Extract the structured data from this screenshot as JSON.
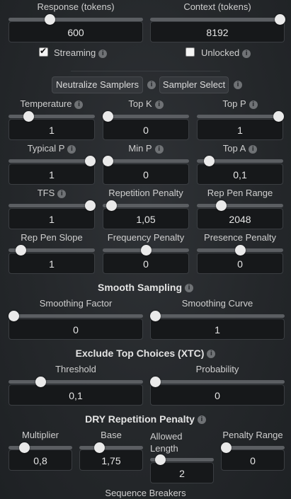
{
  "response": {
    "label": "Response (tokens)",
    "value": "600",
    "fraction": 0.29
  },
  "context": {
    "label": "Context (tokens)",
    "value": "8192",
    "fraction": 1.0
  },
  "streaming": {
    "label": "Streaming",
    "checked": true
  },
  "unlocked": {
    "label": "Unlocked",
    "checked": false
  },
  "buttons": {
    "neutralize": "Neutralize Samplers",
    "sampler_select": "Sampler Select"
  },
  "params": {
    "temperature": {
      "label": "Temperature",
      "value": "1",
      "fraction": 0.2
    },
    "top_k": {
      "label": "Top K",
      "value": "0",
      "fraction": 0.0
    },
    "top_p": {
      "label": "Top P",
      "value": "1",
      "fraction": 1.0
    },
    "typical_p": {
      "label": "Typical P",
      "value": "1",
      "fraction": 1.0
    },
    "min_p": {
      "label": "Min P",
      "value": "0",
      "fraction": 0.0
    },
    "top_a": {
      "label": "Top A",
      "value": "0,1",
      "fraction": 0.1
    },
    "tfs": {
      "label": "TFS",
      "value": "1",
      "fraction": 1.0
    },
    "rep_pen": {
      "label": "Repetition Penalty",
      "value": "1,05",
      "fraction": 0.05
    },
    "rep_pen_range": {
      "label": "Rep Pen Range",
      "value": "2048",
      "fraction": 0.25
    },
    "rep_pen_slope": {
      "label": "Rep Pen Slope",
      "value": "1",
      "fraction": 0.1
    },
    "freq_pen": {
      "label": "Frequency Penalty",
      "value": "0",
      "fraction": 0.5
    },
    "pres_pen": {
      "label": "Presence Penalty",
      "value": "0",
      "fraction": 0.5
    }
  },
  "smooth": {
    "title": "Smooth Sampling",
    "factor": {
      "label": "Smoothing Factor",
      "value": "0",
      "fraction": 0.0
    },
    "curve": {
      "label": "Smoothing Curve",
      "value": "1",
      "fraction": 0.0
    }
  },
  "xtc": {
    "title": "Exclude Top Choices (XTC)",
    "threshold": {
      "label": "Threshold",
      "value": "0,1",
      "fraction": 0.22
    },
    "probability": {
      "label": "Probability",
      "value": "0",
      "fraction": 0.0
    }
  },
  "dry": {
    "title": "DRY Repetition Penalty",
    "multiplier": {
      "label": "Multiplier",
      "value": "0,8",
      "fraction": 0.2
    },
    "base": {
      "label": "Base",
      "value": "1,75",
      "fraction": 0.28
    },
    "allowed_length": {
      "label": "Allowed\nLength",
      "value": "2",
      "fraction": 0.1
    },
    "penalty_range": {
      "label": "Penalty Range",
      "value": "0",
      "fraction": 0.0
    }
  },
  "sequence_breakers": {
    "label": "Sequence Breakers"
  }
}
